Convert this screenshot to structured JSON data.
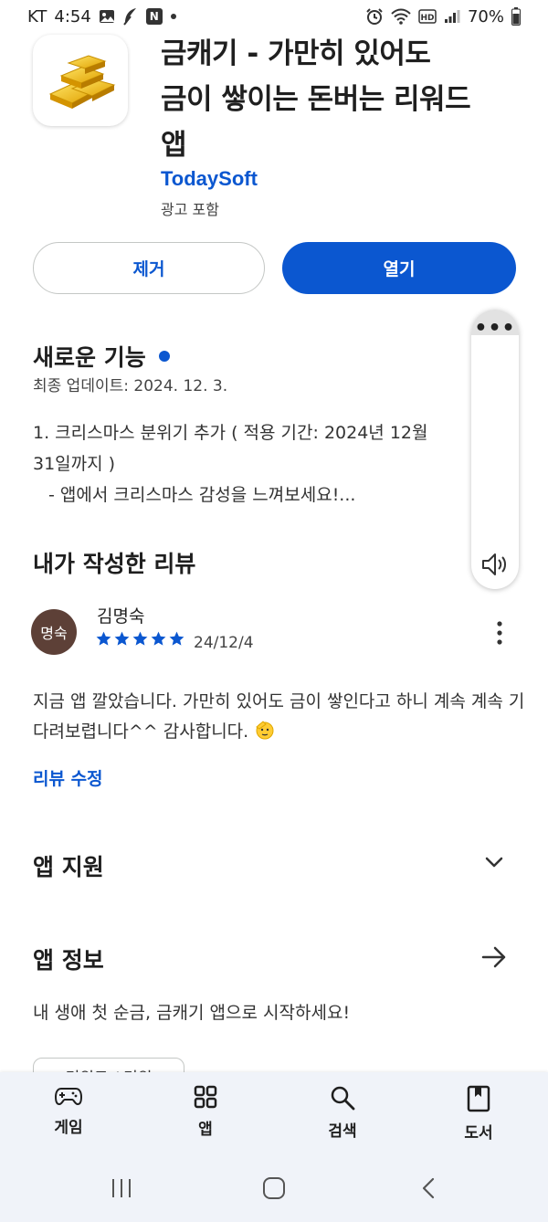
{
  "status_bar": {
    "carrier": "KT",
    "time": "4:54",
    "battery": "70%",
    "notification_letter": "N"
  },
  "app": {
    "title": "금캐기 - 가만히 있어도 금이 쌓이는 돈버는 리워드 앱",
    "title_lines": [
      "금캐기 - 가만히 있어도",
      "금이 쌓이는 돈버는 리워드",
      "앱"
    ],
    "developer": "TodaySoft",
    "ads_note": "광고 포함",
    "icon": "gold-bars-icon"
  },
  "buttons": {
    "remove": "제거",
    "open": "열기"
  },
  "whats_new": {
    "title": "새로운 기능",
    "updated": "최종 업데이트: 2024. 12. 3.",
    "notes": [
      "1. 크리스마스 분위기 추가 ( 적용 기간: 2024년 12월",
      "31일까지 )",
      "- 앱에서 크리스마스 감성을 느껴보세요!..."
    ]
  },
  "my_review": {
    "title": "내가 작성한 리뷰",
    "avatar_text": "명숙",
    "reviewer": "김명숙",
    "rating": 5,
    "date": "24/12/4",
    "text": "지금 앱 깔았습니다. 가만히 있어도 금이 쌓인다고 하니 계속 계속 기다려보렵니다^^ 감사합니다.",
    "edit_label": "리뷰 수정"
  },
  "app_support": {
    "title": "앱 지원"
  },
  "about": {
    "title": "앱 정보",
    "description": "내 생애 첫 순금, 금캐기 앱으로 시작하세요!",
    "chip": "리워드 / 리워"
  },
  "bottom_nav": {
    "items": [
      {
        "label": "게임",
        "icon": "gamepad-icon"
      },
      {
        "label": "앱",
        "icon": "apps-grid-icon"
      },
      {
        "label": "검색",
        "icon": "search-icon"
      },
      {
        "label": "도서",
        "icon": "bookmark-icon"
      }
    ]
  },
  "colors": {
    "accent": "#0b57d0",
    "avatar": "#5d4037",
    "nav_bg": "#f0f3f9"
  }
}
